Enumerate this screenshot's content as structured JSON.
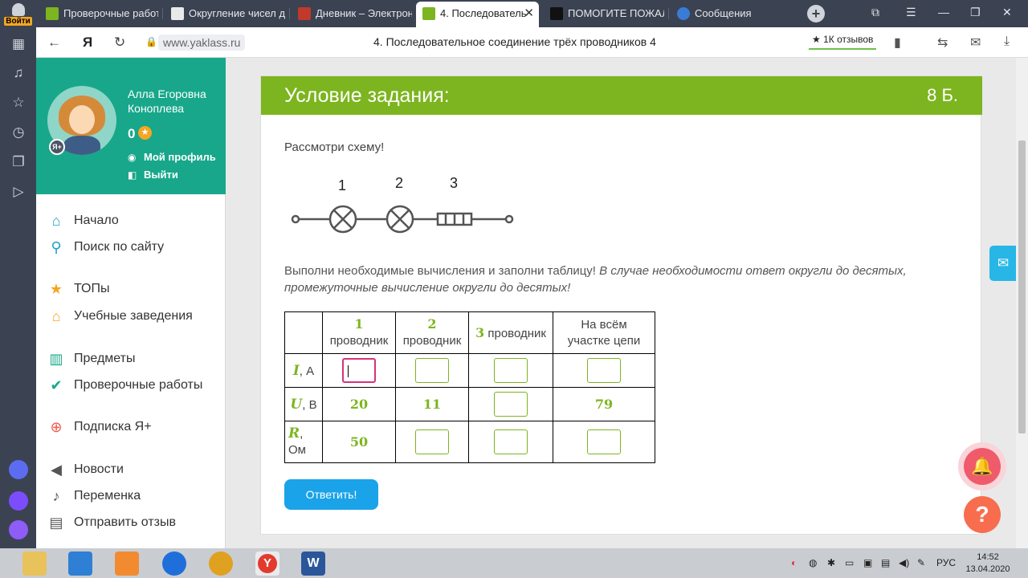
{
  "browser": {
    "login_label": "Войти",
    "tabs": [
      {
        "title": "Проверочные работ",
        "color": "#7cb51f"
      },
      {
        "title": "Округление чисел д",
        "color": "#e9e9e9"
      },
      {
        "title": "Дневник – Электрон",
        "color": "#c0392b"
      },
      {
        "title": "4. Последователь",
        "color": "#7cb51f"
      },
      {
        "title": "ПОМОГИТЕ ПОЖАЛ",
        "color": "#111111"
      },
      {
        "title": "Сообщения",
        "color": "#3a7bd5"
      }
    ],
    "url": "www.yaklass.ru",
    "page_title": "4. Последовательное соединение трёх проводников 4",
    "reviews": "★ 1К отзывов"
  },
  "profile": {
    "name": "Алла Егоровна Коноплева",
    "points": "0",
    "my_profile": "Мой профиль",
    "logout": "Выйти"
  },
  "menu": {
    "home": "Начало",
    "search": "Поиск по сайту",
    "tops": "ТОПы",
    "schools": "Учебные заведения",
    "subjects": "Предметы",
    "tests": "Проверочные работы",
    "subscription": "Подписка Я+",
    "news": "Новости",
    "break": "Переменка",
    "feedback": "Отправить отзыв"
  },
  "task": {
    "header": "Условие задания:",
    "points": "8 Б.",
    "prompt": "Рассмотри схему!",
    "circuit_labels": [
      "1",
      "2",
      "3"
    ],
    "instruction": "Выполни необходимые вычисления и заполни таблицу!",
    "instruction_italic": "В случае необходимости ответ округли до десятых, промежуточные вычисление округли  до десятых!",
    "table": {
      "col1_num": "1",
      "col1_word": "проводник",
      "col2_num": "2",
      "col2_word": "проводник",
      "col3_num": "3",
      "col3_word": " проводник",
      "col4_line1": "На всём",
      "col4_line2": "участке цепи",
      "row_i_var": "I",
      "row_i_unit": ", А",
      "row_u_var": "U",
      "row_u_unit": ", В",
      "row_r_var": "R",
      "row_r_unit1": ",",
      "row_r_unit2": "Ом",
      "u1": "20",
      "u2": "11",
      "u_total": "79",
      "r1": "50"
    },
    "submit": "Ответить!"
  },
  "taskbar": {
    "lang": "РУС",
    "time": "14:52",
    "date": "13.04.2020"
  }
}
